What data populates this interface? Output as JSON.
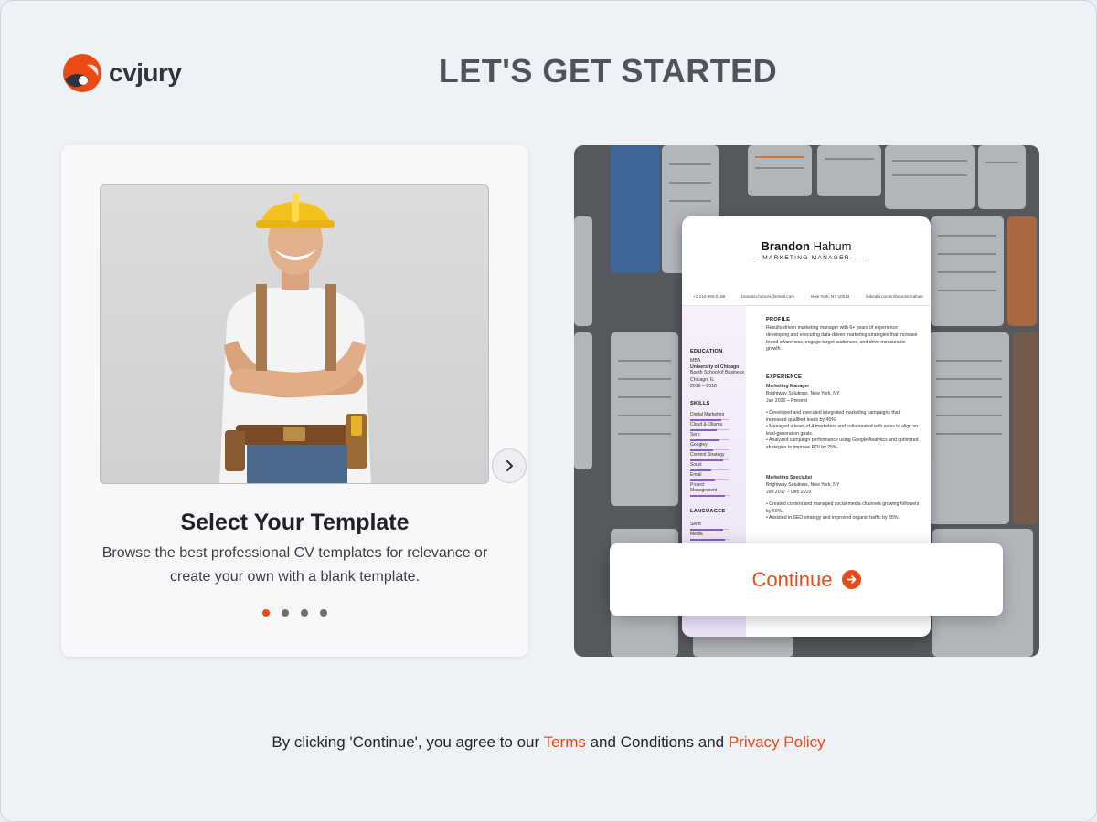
{
  "brand": {
    "name": "cvjury",
    "accent": "#ea4b16"
  },
  "page": {
    "title": "LET'S GET STARTED"
  },
  "carousel": {
    "title": "Select Your Template",
    "description": "Browse the best professional CV templates for relevance or create your own with a blank template.",
    "slide_count": 4,
    "active_slide": 1,
    "next_icon": "chevron-right-icon"
  },
  "resume_preview": {
    "first_name": "Brandon",
    "last_name": "Hahum",
    "role": "MARKETING MANAGER",
    "contact": [
      "+1 210-555-0198",
      "brandon.hahum@email.com",
      "New York, NY 10014",
      "linkedin.com/in/brandonhahum"
    ],
    "education": {
      "heading": "EDUCATION",
      "degree": "MBA",
      "school": "University of Chicago",
      "subschool": "Booth School of Business",
      "location": "Chicago, IL",
      "years": "2016 – 2018"
    },
    "skills": {
      "heading": "SKILLS",
      "items": [
        "Digital Marketing",
        "Cloud & Ollama",
        "Serp",
        "Googley",
        "Content Strategy",
        "Sousl",
        "Email",
        "Project Management"
      ]
    },
    "languages": {
      "heading": "LANGUAGES",
      "items": [
        "Serdl",
        "Media"
      ]
    },
    "profile": {
      "heading": "PROFILE",
      "text": "Results-driven marketing manager with 6+ years of experience developing and executing data-driven marketing strategies that increase brand awareness, engage target audiences, and drive measurable growth."
    },
    "experience": {
      "heading": "EXPERIENCE",
      "jobs": [
        {
          "title": "Marketing Manager",
          "company": "Brightway Solutions, New York, NY",
          "dates": "Jan 2020 – Present",
          "bullets": [
            "Developed and executed integrated marketing campaigns that increased qualified leads by 45%.",
            "Managed a team of 4 marketers and collaborated with sales to align on lead-generation goals.",
            "Analyzed campaign performance using Google Analytics and optimized strategies to improve ROI by 25%."
          ]
        },
        {
          "title": "Marketing Specialist",
          "company": "Brightway Solutions, New York, NY",
          "dates": "Jun 2017 – Dec 2019",
          "bullets": [
            "Created content and managed social media channels growing followers by 60%.",
            "Assisted in SEO strategy and improved organic traffic by 35%."
          ]
        }
      ]
    }
  },
  "cta": {
    "label": "Continue",
    "icon": "arrow-right-circle-icon"
  },
  "footer": {
    "prefix": "By clicking 'Continue', you agree to our ",
    "terms_link": "Terms",
    "middle": " and Conditions and ",
    "privacy_link": "Privacy Policy"
  }
}
